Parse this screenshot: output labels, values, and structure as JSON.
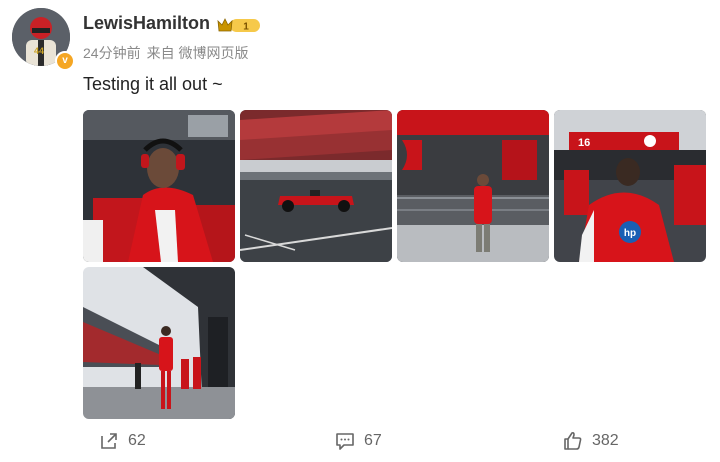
{
  "user": {
    "name": "LewisHamilton",
    "vip_level": "1",
    "avatar_number": "44"
  },
  "post": {
    "time": "24分钟前",
    "source": "来自 微博网页版",
    "text": "Testing it all out ~",
    "images": [
      {
        "icon": "photo-headset"
      },
      {
        "icon": "photo-car-track"
      },
      {
        "icon": "photo-garage"
      },
      {
        "icon": "photo-team-back",
        "garage_number": "16",
        "sponsor": "hp"
      },
      {
        "icon": "photo-pitlane"
      }
    ]
  },
  "actions": {
    "repost_count": "62",
    "comment_count": "67",
    "like_count": "382"
  },
  "colors": {
    "ferrari_red": "#d7141a",
    "vip_gold": "#f5c242",
    "verified_orange": "#f5a623"
  }
}
